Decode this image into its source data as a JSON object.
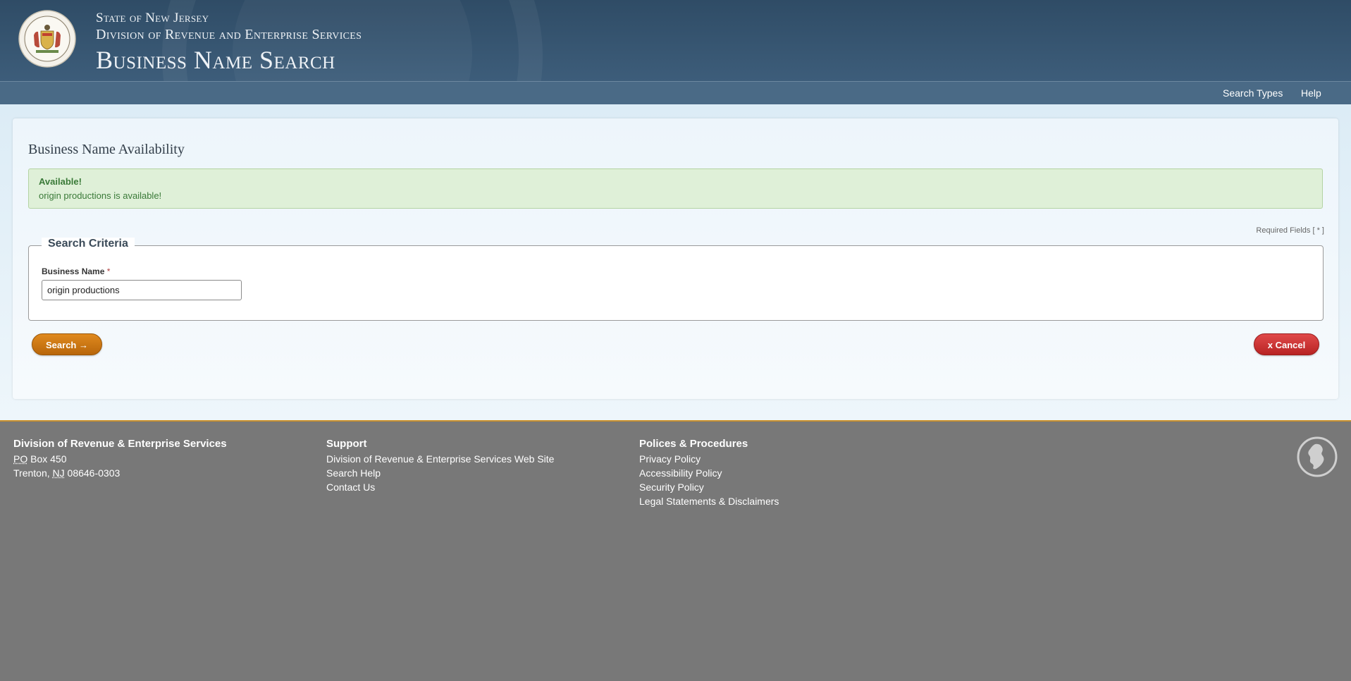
{
  "header": {
    "state": "State of New Jersey",
    "division": "Division of Revenue and Enterprise Services",
    "title": "Business Name Search",
    "seal_icon": "nj-state-seal"
  },
  "nav": {
    "search_types": "Search Types",
    "help": "Help"
  },
  "main": {
    "title": "Business Name Availability",
    "alert": {
      "heading": "Available!",
      "message": "origin productions is available!",
      "color": "#dff0d8"
    },
    "required_note": "Required Fields [ * ]",
    "fieldset_legend": "Search Criteria",
    "business_name": {
      "label": "Business Name",
      "required_marker": "*",
      "value": "origin productions"
    },
    "search_button": "Search →",
    "cancel_button": "x Cancel"
  },
  "footer": {
    "col1": {
      "heading": "Division of Revenue & Enterprise Services",
      "po_abbr": "PO",
      "po_rest": " Box 450",
      "city": "Trenton, ",
      "state_abbr": "NJ",
      "zip": " 08646-0303"
    },
    "col2": {
      "heading": "Support",
      "links": [
        "Division of Revenue & Enterprise Services Web Site",
        "Search Help",
        "Contact Us"
      ]
    },
    "col3": {
      "heading": "Polices & Procedures",
      "links": [
        "Privacy Policy",
        "Accessibility Policy",
        "Security Policy",
        "Legal Statements & Disclaimers"
      ]
    },
    "nj_icon": "nj-state-outline-icon"
  },
  "colors": {
    "header": "#2f4c66",
    "navbar": "#4a6a86",
    "search_button": "#d07a15",
    "cancel_button": "#d03a3a",
    "footer": "#787878",
    "footer_border": "#c8902e"
  }
}
